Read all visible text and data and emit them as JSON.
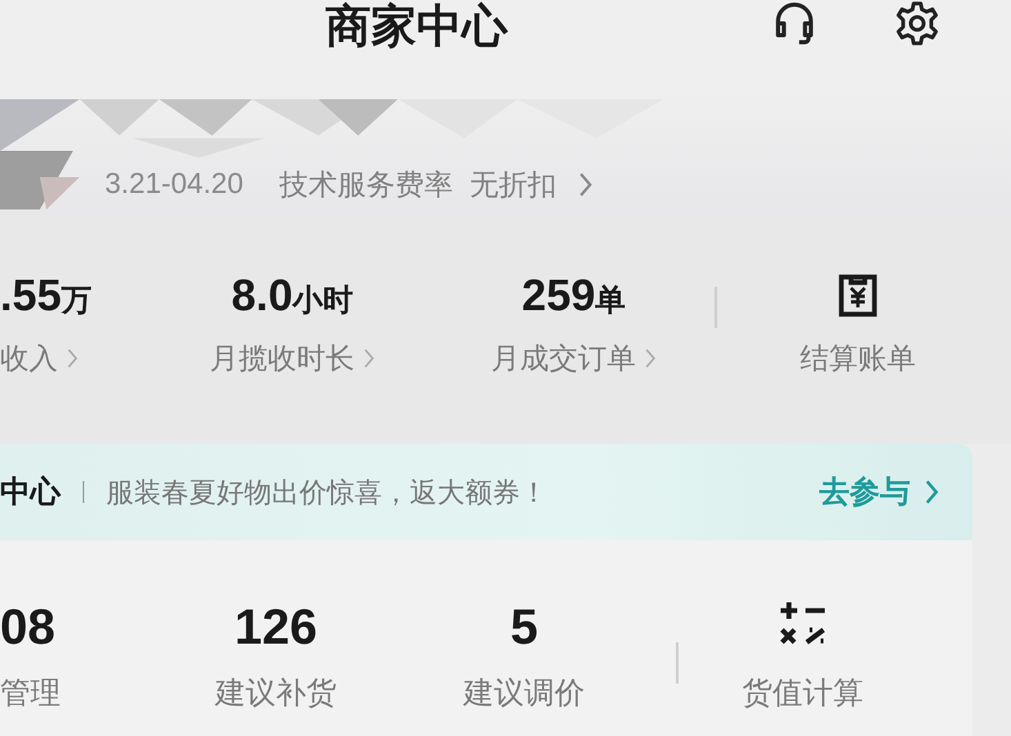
{
  "header": {
    "title": "商家中心"
  },
  "account": {
    "date_range": "3.21-04.20",
    "fee_label": "技术服务费率",
    "fee_value": "无折扣"
  },
  "stats": [
    {
      "kind": "stat",
      "value": ".55",
      "unit": "万",
      "label": "收入"
    },
    {
      "kind": "stat",
      "value": "8.0",
      "unit": "小时",
      "label": "月揽收时长"
    },
    {
      "kind": "stat",
      "value": "259",
      "unit": "单",
      "label": "月成交订单"
    },
    {
      "kind": "bill",
      "label": "结算账单"
    }
  ],
  "banner": {
    "title": "中心",
    "text": "服装春夏好物出价惊喜，返大额券！",
    "action": "去参与"
  },
  "tools": [
    {
      "kind": "stat",
      "value": "08",
      "label": "管理"
    },
    {
      "kind": "stat",
      "value": "126",
      "label": "建议补货"
    },
    {
      "kind": "stat",
      "value": "5",
      "label": "建议调价"
    },
    {
      "kind": "calculator",
      "label": "货值计算"
    }
  ]
}
